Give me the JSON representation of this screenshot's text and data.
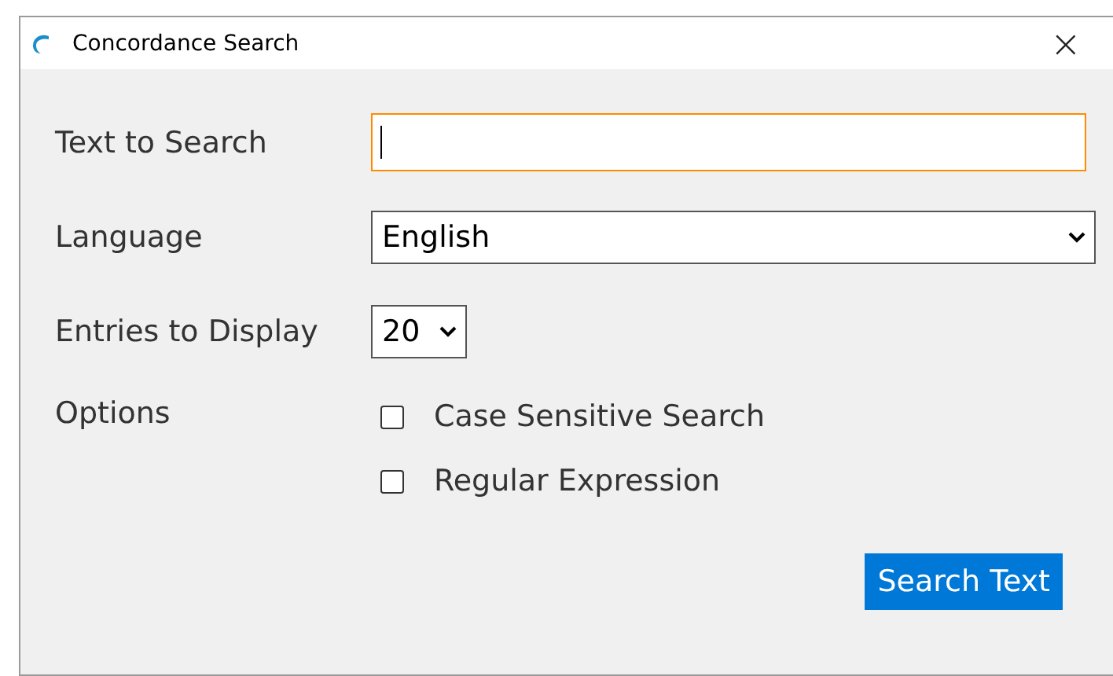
{
  "window": {
    "title": "Concordance Search",
    "close": "×"
  },
  "fields": [
    {
      "kind": "text",
      "label": "Text to Search",
      "focused": true
    },
    {
      "kind": "select",
      "label": "Language",
      "value": "English",
      "wide": true
    },
    {
      "kind": "select",
      "label": "Entries to Display",
      "value": "20",
      "wide": false
    }
  ],
  "options": {
    "label": "Options",
    "items": [
      {
        "label": "Case Sensitive Search",
        "checked": false
      },
      {
        "label": "Regular Expression",
        "checked": false
      }
    ]
  },
  "buttons": [
    {
      "label": "Search Text"
    }
  ]
}
